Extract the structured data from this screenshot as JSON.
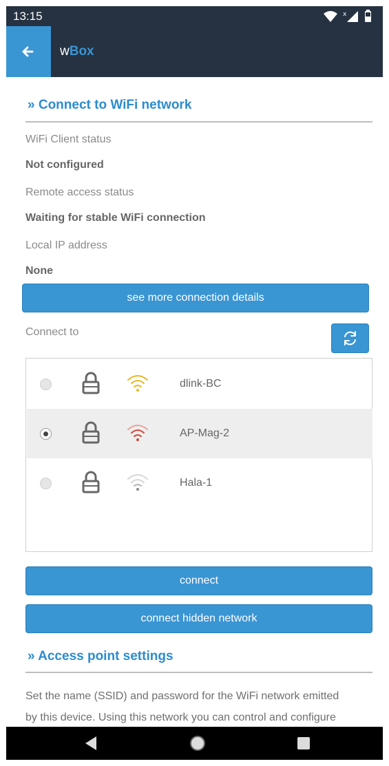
{
  "status_bar": {
    "time": "13:15"
  },
  "app_bar": {
    "title_prefix": "w",
    "title_brand": "Box"
  },
  "wifi_section": {
    "title": "» Connect to WiFi network",
    "client_status_label": "WiFi Client status",
    "client_status_value": "Not configured",
    "remote_status_label": "Remote access status",
    "remote_status_value": "Waiting for stable WiFi connection",
    "ip_label": "Local IP address",
    "ip_value": "None",
    "details_button": "see more connection details",
    "connect_to_label": "Connect to",
    "networks": [
      {
        "ssid": "dlink-BC",
        "selected": false,
        "signal_color": "#e8b820"
      },
      {
        "ssid": "AP-Mag-2",
        "selected": true,
        "signal_color": "#d0473a"
      },
      {
        "ssid": "Hala-1",
        "selected": false,
        "signal_color": "#b5b5b5"
      }
    ],
    "connect_button": "connect",
    "connect_hidden_button": "connect hidden network"
  },
  "ap_section": {
    "title": "» Access point settings",
    "description_line1": "Set the name (SSID) and password for the WiFi network emitted",
    "description_line2": "by this device. Using this network you can control and configure"
  },
  "colors": {
    "accent": "#3a95d3",
    "header_bg": "#263241",
    "section_title": "#2c8bd0"
  },
  "icons": {
    "back": "arrow-left-icon",
    "refresh": "refresh-icon",
    "lock": "lock-icon",
    "wifi": "wifi-signal-icon"
  }
}
